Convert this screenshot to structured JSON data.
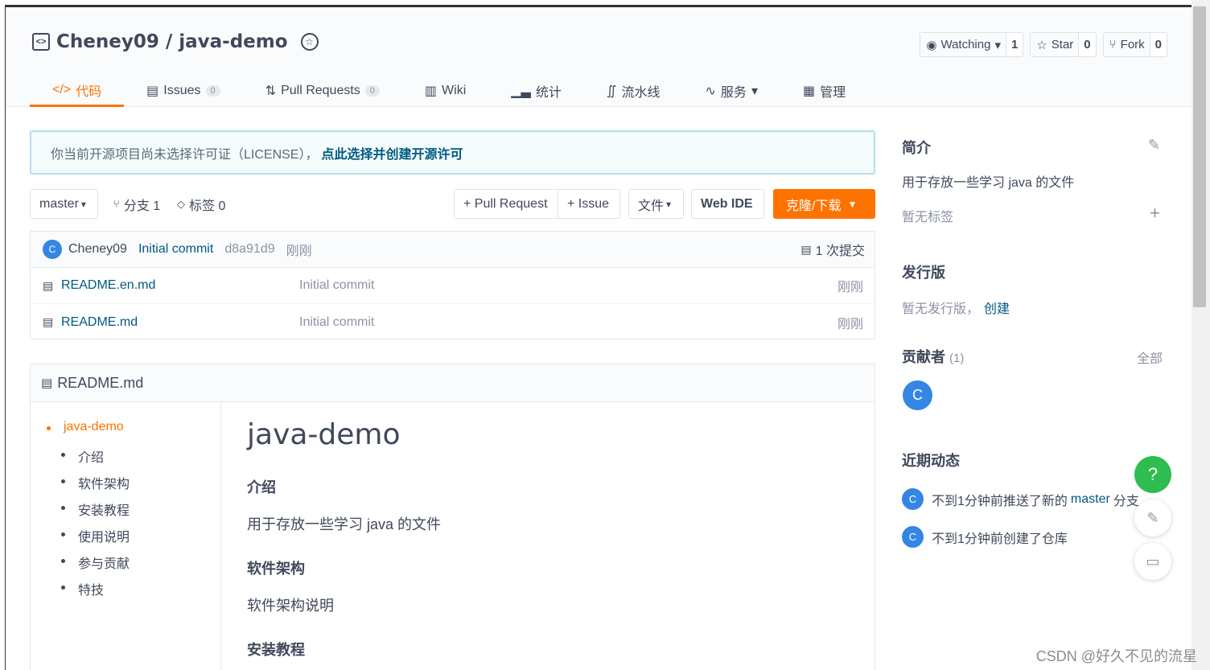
{
  "repo": {
    "title": "Cheney09 / java-demo",
    "icon": "repo-code-icon",
    "badge_icon": "award-icon"
  },
  "actions": {
    "watch_label": "Watching",
    "watch_count": "1",
    "star_label": "Star",
    "star_count": "0",
    "fork_label": "Fork",
    "fork_count": "0"
  },
  "tabs": [
    {
      "label": "代码",
      "icon": "code-icon"
    },
    {
      "label": "Issues",
      "count": "0",
      "icon": "issues-icon"
    },
    {
      "label": "Pull Requests",
      "count": "0",
      "icon": "pull-request-icon"
    },
    {
      "label": "Wiki",
      "icon": "wiki-icon"
    },
    {
      "label": "统计",
      "icon": "chart-icon"
    },
    {
      "label": "流水线",
      "icon": "pipeline-icon"
    },
    {
      "label": "服务",
      "icon": "pulse-icon"
    },
    {
      "label": "管理",
      "icon": "manage-icon"
    }
  ],
  "license": {
    "text": "你当前开源项目尚未选择许可证（LICENSE），",
    "link": "点此选择并创建开源许可"
  },
  "toolbar": {
    "branch": "master",
    "branches": "分支 1",
    "tags": "标签 0",
    "pull_request": "+ Pull Request",
    "issue": "+ Issue",
    "files": "文件",
    "web_ide": "Web IDE",
    "clone": "克隆/下载"
  },
  "commit": {
    "avatar": "C",
    "author": "Cheney09",
    "message": "Initial commit",
    "hash": "d8a91d9",
    "time": "刚刚",
    "count": "1 次提交"
  },
  "files": [
    {
      "name": "README.en.md",
      "message": "Initial commit",
      "time": "刚刚"
    },
    {
      "name": "README.md",
      "message": "Initial commit",
      "time": "刚刚"
    }
  ],
  "readme": {
    "title": "README.md",
    "toc": [
      "java-demo",
      "介绍",
      "软件架构",
      "安装教程",
      "使用说明",
      "参与贡献",
      "特技"
    ],
    "h1": "java-demo",
    "sec1_title": "介绍",
    "sec1_text": "用于存放一些学习 java 的文件",
    "sec2_title": "软件架构",
    "sec2_text": "软件架构说明",
    "sec3_title": "安装教程"
  },
  "sidebar": {
    "intro_title": "简介",
    "intro_text": "用于存放一些学习 java 的文件",
    "no_tags": "暂无标签",
    "release_title": "发行版",
    "no_release": "暂无发行版，",
    "create": "创建",
    "contributors_title": "贡献者",
    "contributors_count": "(1)",
    "all": "全部",
    "contributor_avatar": "C",
    "activity_title": "近期动态",
    "activity1_prefix": "不到1分钟前推送了新的",
    "activity1_branch": "master",
    "activity1_suffix": "分支",
    "activity2": "不到1分钟前创建了仓库",
    "activity_avatar": "C"
  },
  "float": {
    "help": "?"
  },
  "watermark": "CSDN @好久不见的流星"
}
